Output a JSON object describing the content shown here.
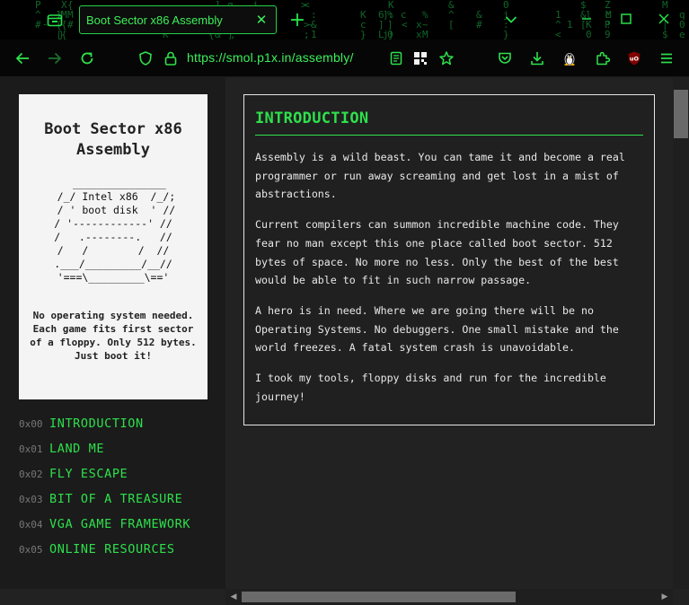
{
  "tab": {
    "title": "Boot Sector x86 Assembly",
    "close_glyph": "✕"
  },
  "toolbar": {
    "url": "https://smol.p1x.in/assembly/",
    "new_tab_glyph": "+"
  },
  "logo": {
    "title": "Boot Sector x86\nAssembly",
    "ascii": "  _______________\n /_/ Intel x86  /_/;\n / ' boot disk  ' //\n/ '------------' //\n/   .--------.   //\n/   /        /  //\n.___/_________/__//\n'===\\_________\\=='",
    "description": "No operating system needed. Each game fits first sector of a floppy. Only 512 bytes. Just boot it!"
  },
  "menu": [
    {
      "num": "0x00",
      "label": "INTRODUCTION"
    },
    {
      "num": "0x01",
      "label": "LAND ME"
    },
    {
      "num": "0x02",
      "label": "FLY ESCAPE"
    },
    {
      "num": "0x03",
      "label": "BIT OF A TREASURE"
    },
    {
      "num": "0x04",
      "label": "VGA GAME FRAMEWORK"
    },
    {
      "num": "0x05",
      "label": "ONLINE RESOURCES"
    }
  ],
  "content": {
    "title": "INTRODUCTION",
    "paragraphs": [
      "Assembly is a wild beast. You can tame it and become a real programmer or run away screaming and get lost in a mist of abstractions.",
      "Current compilers can summon incredible machine code. They fear no man except this one place called boot sector. 512 bytes of space. No more no less. Only the best of the best would be able to fit in such narrow passage.",
      "A hero is in need. Where we are going there will be no Operating Systems. No debuggers. One small mistake and the world freezes. A fatal system crash is unavoidable.",
      "I took my tools, floppy disks and run for the incredible journey!"
    ]
  },
  "colors": {
    "accent": "#2ee04c",
    "background": "#222222",
    "sidebar": "#1b1b1b"
  },
  "icons": [
    "tab-list-icon",
    "new-tab-icon",
    "list-all-tabs-icon",
    "minimize-icon",
    "maximize-icon",
    "window-close-icon",
    "back-icon",
    "forward-icon",
    "reload-icon",
    "shield-icon",
    "lock-icon",
    "reader-view-icon",
    "qr-code-icon",
    "bookmark-star-icon",
    "pocket-icon",
    "download-icon",
    "linux-tux-icon",
    "extensions-icon",
    "ublock-icon",
    "hamburger-menu-icon"
  ]
}
